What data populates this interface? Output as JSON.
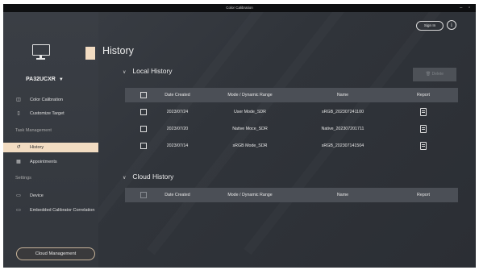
{
  "window": {
    "title": "Color Calibration",
    "minimize": "–",
    "maximize": "▫"
  },
  "sidebar": {
    "monitor_icon": "monitor-icon",
    "model": "PA32UCXR",
    "model_caret": "▼",
    "items": [
      {
        "label": "Color Calibration",
        "icon": "◫"
      },
      {
        "label": "Customize Target",
        "icon": "▯"
      }
    ],
    "task_heading": "Task Management",
    "task_items": [
      {
        "label": "History",
        "icon": "↺",
        "active": true
      },
      {
        "label": "Appointments",
        "icon": "▦"
      }
    ],
    "settings_heading": "Settings",
    "settings_items": [
      {
        "label": "Device",
        "icon": "▭"
      },
      {
        "label": "Embedded Calibrator Correlation",
        "icon": "▭"
      }
    ],
    "cloud_button": "Cloud Management"
  },
  "header": {
    "page_title": "History",
    "sign_in": "Sign In",
    "info": "i"
  },
  "local_history": {
    "title": "Local History",
    "chevron": "∨",
    "delete_label": "🗑 Delete",
    "columns": [
      "Date Created",
      "Mode / Dynamic Range",
      "Name",
      "Report"
    ],
    "rows": [
      {
        "date": "2023/07/24",
        "mode": "User Mode_SDR",
        "name": "sRGB_202307241100"
      },
      {
        "date": "2023/07/20",
        "mode": "Native Moce_SDR",
        "name": "Native_202307201711"
      },
      {
        "date": "2023/07/14",
        "mode": "sRGB Mode_SDR",
        "name": "sRGB_202307141504"
      }
    ]
  },
  "cloud_history": {
    "title": "Cloud History",
    "chevron": "∨",
    "columns": [
      "Date Created",
      "Mode / Dynamic Range",
      "Name",
      "Report"
    ]
  },
  "colors": {
    "accent": "#f2dcc2",
    "background": "#2f3339",
    "header_row": "#4b4f56"
  }
}
